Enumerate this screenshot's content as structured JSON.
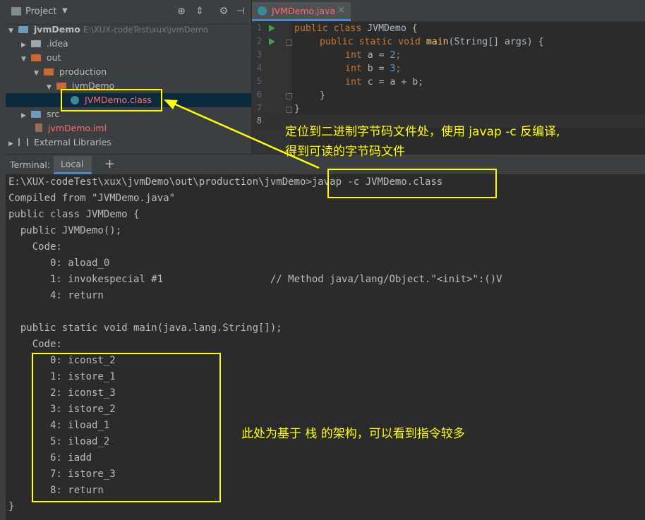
{
  "project_panel": {
    "title": "Project",
    "tree": [
      {
        "label": "jvmDemo",
        "path": "E:\\XUX-codeTest\\xux\\jvmDemo"
      },
      {
        "label": ".idea"
      },
      {
        "label": "out"
      },
      {
        "label": "production"
      },
      {
        "label": "jvmDemo"
      },
      {
        "label": "JVMDemo.class"
      },
      {
        "label": "src"
      },
      {
        "label": "jvmDemo.iml"
      },
      {
        "label": "External Libraries"
      }
    ]
  },
  "editor": {
    "tab_label": "JVMDemo.java",
    "line_numbers": [
      "1",
      "2",
      "3",
      "4",
      "5",
      "6",
      "7",
      "8"
    ],
    "code": [
      {
        "parts": [
          "public class ",
          "JVMDemo {"
        ]
      },
      {
        "parts": [
          "public static void ",
          "main",
          "(String[] args) {"
        ]
      },
      {
        "parts": [
          "int ",
          "a = ",
          "2",
          ";"
        ]
      },
      {
        "parts": [
          "int ",
          "b = ",
          "3",
          ";"
        ]
      },
      {
        "parts": [
          "int ",
          "c = a + b;"
        ]
      },
      {
        "parts": [
          "}"
        ]
      },
      {
        "parts": [
          "}"
        ]
      }
    ]
  },
  "terminal": {
    "title": "Terminal:",
    "tab_label": "Local",
    "add_label": "+",
    "lines": [
      "E:\\XUX-codeTest\\xux\\jvmDemo\\out\\production\\jvmDemo>javap -c JVMDemo.class",
      "Compiled from \"JVMDemo.java\"",
      "public class JVMDemo {",
      "  public JVMDemo();",
      "    Code:",
      "       0: aload_0",
      "       1: invokespecial #1                  // Method java/lang/Object.\"<init>\":()V",
      "       4: return",
      "",
      "  public static void main(java.lang.String[]);",
      "    Code:",
      "       0: iconst_2",
      "       1: istore_1",
      "       2: iconst_3",
      "       3: istore_2",
      "       4: iload_1",
      "       5: iload_2",
      "       6: iadd",
      "       7: istore_3",
      "       8: return",
      "}"
    ]
  },
  "annotations": {
    "top_line1": "定位到二进制字节码文件处，使用 javap -c 反编译,",
    "top_line2": "得到可读的字节码文件",
    "stack_note": "此处为基于 栈 的架构，可以看到指令较多",
    "annotation_color": "#ffff00"
  }
}
